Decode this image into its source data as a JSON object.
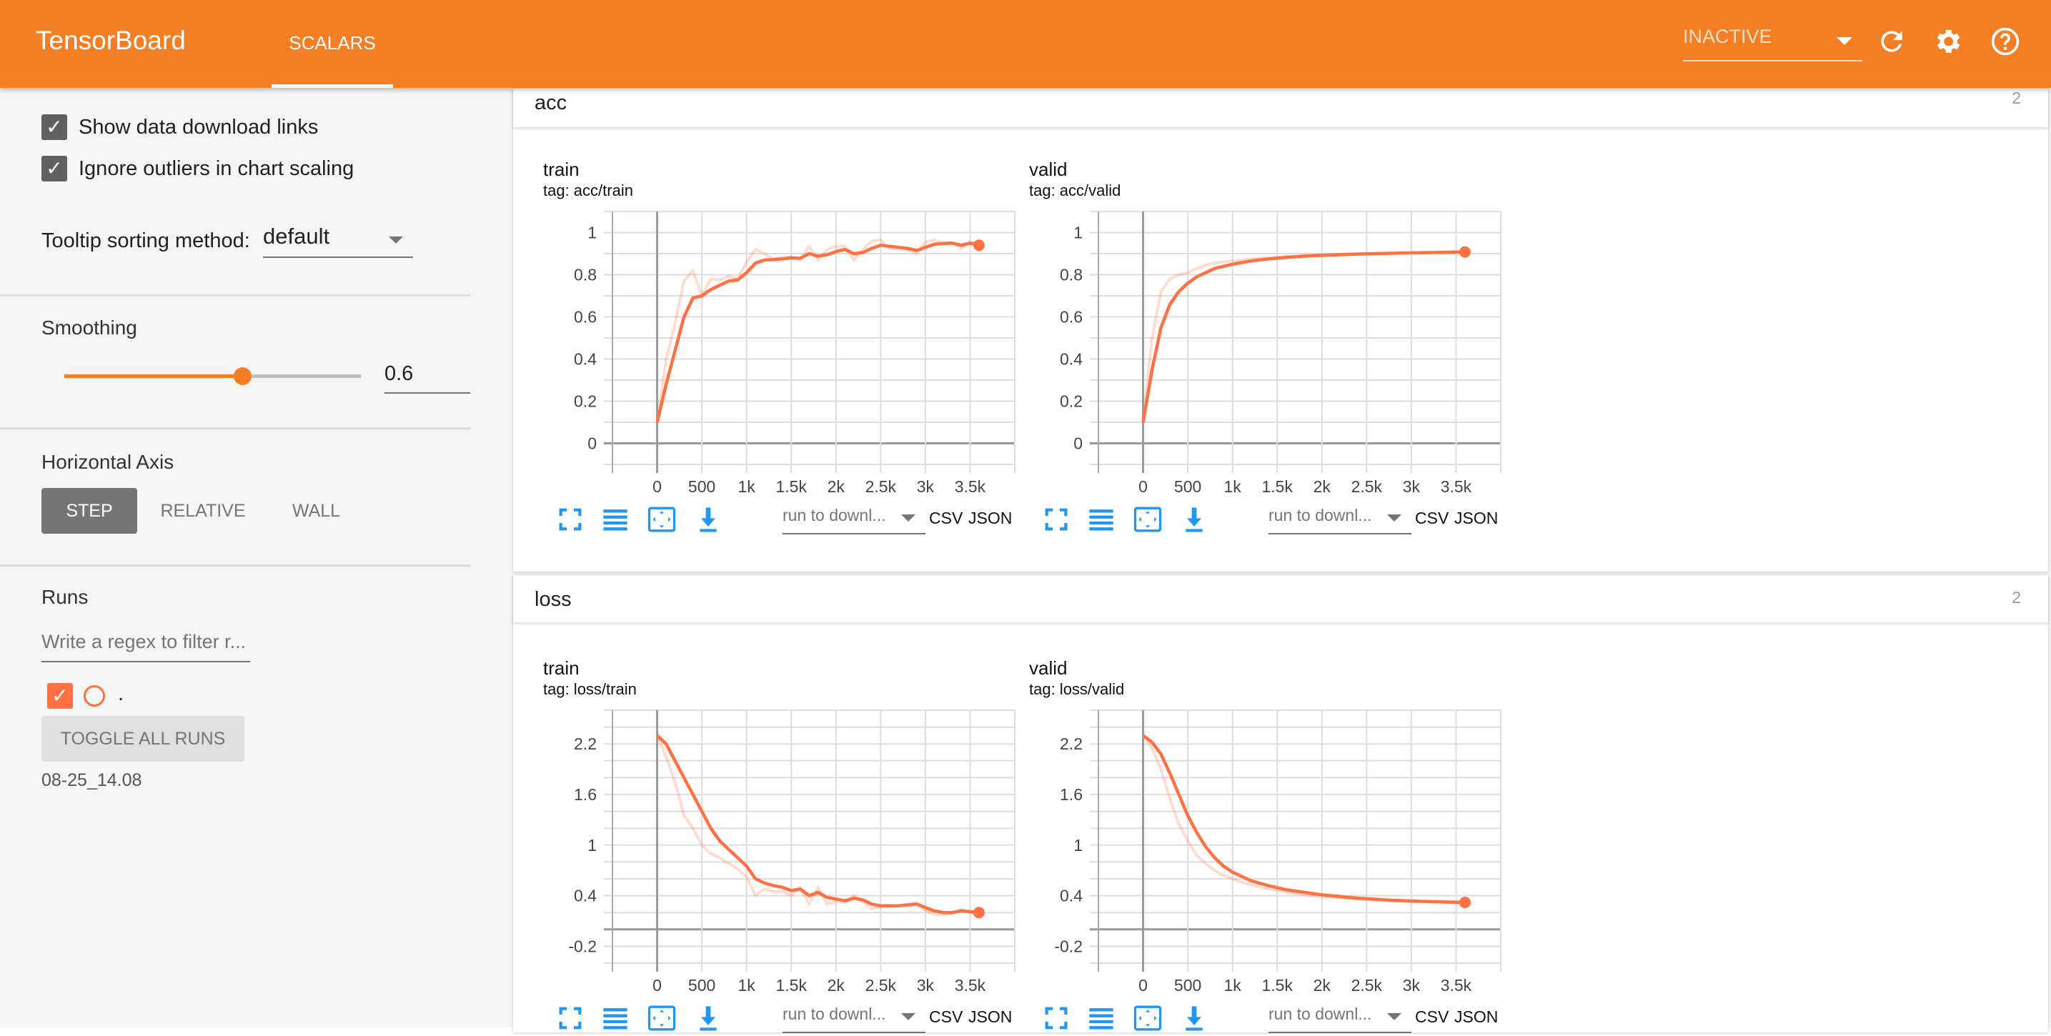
{
  "header": {
    "brand": "TensorBoard",
    "tab": "SCALARS",
    "run_state": "INACTIVE",
    "icons": [
      "refresh-icon",
      "gear-icon",
      "help-icon"
    ],
    "color": "#f47e23"
  },
  "sidebar": {
    "show_download_links": {
      "label": "Show data download links",
      "checked": true
    },
    "ignore_outliers": {
      "label": "Ignore outliers in chart scaling",
      "checked": true
    },
    "tooltip_label": "Tooltip sorting method:",
    "tooltip_value": "default",
    "smoothing_label": "Smoothing",
    "smoothing_value": "0.6",
    "smoothing_fraction": 0.6,
    "axis_label": "Horizontal Axis",
    "axis_options": [
      "STEP",
      "RELATIVE",
      "WALL"
    ],
    "axis_selected": "STEP",
    "runs_label": "Runs",
    "runs_filter_placeholder": "Write a regex to filter r...",
    "runs": [
      {
        "name": ".",
        "checked": true,
        "color": "#ff7043"
      }
    ],
    "toggle_all": "TOGGLE ALL RUNS",
    "run_dir": "08-25_14.08"
  },
  "toolbar": {
    "download_placeholder": "run to downl...",
    "csv": "CSV",
    "json": "JSON"
  },
  "cards": [
    {
      "name": "acc",
      "count": "2"
    },
    {
      "name": "loss",
      "count": "2"
    }
  ],
  "chart_data": [
    {
      "type": "line",
      "title": "train",
      "subtitle": "tag: acc/train",
      "xlim": [
        -500,
        4000
      ],
      "ylim": [
        -0.1,
        1.1
      ],
      "xticks": [
        0,
        500,
        1000,
        1500,
        2000,
        2500,
        3000,
        3500
      ],
      "xticklabels": [
        "0",
        "500",
        "1k",
        "1.5k",
        "2k",
        "2.5k",
        "3k",
        "3.5k"
      ],
      "yticks": [
        0,
        0.2,
        0.4,
        0.6,
        0.8,
        1
      ],
      "yticklabels": [
        "0",
        "0.2",
        "0.4",
        "0.6",
        "0.8",
        "1"
      ],
      "grid": true,
      "ygrid_step": 0.1,
      "color": "#ff7043",
      "x": [
        0,
        100,
        200,
        300,
        400,
        500,
        600,
        700,
        800,
        900,
        1000,
        1100,
        1200,
        1300,
        1400,
        1500,
        1600,
        1700,
        1800,
        1900,
        2000,
        2100,
        2200,
        2300,
        2400,
        2500,
        2600,
        2700,
        2800,
        2900,
        3000,
        3100,
        3200,
        3300,
        3400,
        3500,
        3600
      ],
      "raw": [
        0.1,
        0.4,
        0.57,
        0.77,
        0.82,
        0.7,
        0.78,
        0.775,
        0.795,
        0.78,
        0.86,
        0.92,
        0.9,
        0.875,
        0.88,
        0.885,
        0.87,
        0.935,
        0.87,
        0.92,
        0.935,
        0.935,
        0.87,
        0.92,
        0.96,
        0.965,
        0.925,
        0.925,
        0.92,
        0.9,
        0.955,
        0.965,
        0.95,
        0.95,
        0.925,
        0.955,
        0.94
      ],
      "smoothed": [
        0.1,
        0.28,
        0.44,
        0.6,
        0.69,
        0.7,
        0.73,
        0.75,
        0.77,
        0.775,
        0.81,
        0.855,
        0.87,
        0.872,
        0.875,
        0.88,
        0.878,
        0.9,
        0.888,
        0.895,
        0.91,
        0.92,
        0.9,
        0.905,
        0.925,
        0.94,
        0.935,
        0.93,
        0.925,
        0.915,
        0.93,
        0.945,
        0.948,
        0.95,
        0.94,
        0.95,
        0.94
      ]
    },
    {
      "type": "line",
      "title": "valid",
      "subtitle": "tag: acc/valid",
      "xlim": [
        -500,
        4000
      ],
      "ylim": [
        -0.1,
        1.1
      ],
      "xticks": [
        0,
        500,
        1000,
        1500,
        2000,
        2500,
        3000,
        3500
      ],
      "xticklabels": [
        "0",
        "500",
        "1k",
        "1.5k",
        "2k",
        "2.5k",
        "3k",
        "3.5k"
      ],
      "yticks": [
        0,
        0.2,
        0.4,
        0.6,
        0.8,
        1
      ],
      "yticklabels": [
        "0",
        "0.2",
        "0.4",
        "0.6",
        "0.8",
        "1"
      ],
      "grid": true,
      "ygrid_step": 0.1,
      "color": "#ff7043",
      "x": [
        0,
        100,
        200,
        300,
        400,
        500,
        600,
        700,
        800,
        900,
        1000,
        1200,
        1400,
        1600,
        1800,
        2000,
        2400,
        2800,
        3200,
        3600
      ],
      "raw": [
        0.1,
        0.5,
        0.72,
        0.78,
        0.8,
        0.81,
        0.83,
        0.845,
        0.855,
        0.86,
        0.865,
        0.875,
        0.88,
        0.885,
        0.89,
        0.895,
        0.9,
        0.903,
        0.906,
        0.909
      ],
      "smoothed": [
        0.1,
        0.35,
        0.55,
        0.66,
        0.72,
        0.76,
        0.79,
        0.81,
        0.83,
        0.84,
        0.85,
        0.865,
        0.875,
        0.882,
        0.888,
        0.892,
        0.898,
        0.902,
        0.905,
        0.908
      ]
    },
    {
      "type": "line",
      "title": "train",
      "subtitle": "tag: loss/train",
      "xlim": [
        -500,
        4000
      ],
      "ylim": [
        -0.4,
        2.6
      ],
      "xticks": [
        0,
        500,
        1000,
        1500,
        2000,
        2500,
        3000,
        3500
      ],
      "xticklabels": [
        "0",
        "500",
        "1k",
        "1.5k",
        "2k",
        "2.5k",
        "3k",
        "3.5k"
      ],
      "yticks": [
        -0.2,
        0.4,
        1,
        1.6,
        2.2
      ],
      "yticklabels": [
        "-0.2",
        "0.4",
        "1",
        "1.6",
        "2.2"
      ],
      "grid": true,
      "ygrid_step": 0.2,
      "color": "#ff7043",
      "x": [
        0,
        100,
        200,
        300,
        400,
        500,
        600,
        700,
        800,
        900,
        1000,
        1100,
        1200,
        1300,
        1400,
        1500,
        1600,
        1700,
        1800,
        1900,
        2000,
        2100,
        2200,
        2300,
        2400,
        2500,
        2600,
        2700,
        2800,
        2900,
        3000,
        3100,
        3200,
        3300,
        3400,
        3500,
        3600
      ],
      "raw": [
        2.3,
        2.05,
        1.75,
        1.35,
        1.2,
        1.0,
        0.9,
        0.85,
        0.78,
        0.72,
        0.62,
        0.4,
        0.48,
        0.45,
        0.45,
        0.4,
        0.5,
        0.3,
        0.5,
        0.3,
        0.33,
        0.32,
        0.4,
        0.33,
        0.25,
        0.26,
        0.27,
        0.28,
        0.3,
        0.32,
        0.22,
        0.18,
        0.17,
        0.19,
        0.24,
        0.2,
        0.19
      ],
      "smoothed": [
        2.3,
        2.2,
        2.0,
        1.8,
        1.6,
        1.4,
        1.2,
        1.05,
        0.95,
        0.85,
        0.75,
        0.6,
        0.55,
        0.52,
        0.5,
        0.46,
        0.48,
        0.4,
        0.44,
        0.38,
        0.36,
        0.34,
        0.37,
        0.35,
        0.3,
        0.28,
        0.28,
        0.28,
        0.29,
        0.3,
        0.26,
        0.22,
        0.2,
        0.2,
        0.22,
        0.21,
        0.2
      ]
    },
    {
      "type": "line",
      "title": "valid",
      "subtitle": "tag: loss/valid",
      "xlim": [
        -500,
        4000
      ],
      "ylim": [
        -0.4,
        2.6
      ],
      "xticks": [
        0,
        500,
        1000,
        1500,
        2000,
        2500,
        3000,
        3500
      ],
      "xticklabels": [
        "0",
        "500",
        "1k",
        "1.5k",
        "2k",
        "2.5k",
        "3k",
        "3.5k"
      ],
      "yticks": [
        -0.2,
        0.4,
        1,
        1.6,
        2.2
      ],
      "yticklabels": [
        "-0.2",
        "0.4",
        "1",
        "1.6",
        "2.2"
      ],
      "grid": true,
      "ygrid_step": 0.2,
      "color": "#ff7043",
      "x": [
        0,
        100,
        200,
        300,
        400,
        500,
        600,
        700,
        800,
        900,
        1000,
        1200,
        1400,
        1600,
        1800,
        2000,
        2400,
        2800,
        3200,
        3600
      ],
      "raw": [
        2.3,
        2.15,
        1.9,
        1.55,
        1.25,
        1.05,
        0.88,
        0.78,
        0.7,
        0.64,
        0.6,
        0.53,
        0.48,
        0.44,
        0.41,
        0.39,
        0.36,
        0.34,
        0.33,
        0.32
      ],
      "smoothed": [
        2.3,
        2.22,
        2.08,
        1.85,
        1.6,
        1.35,
        1.15,
        0.98,
        0.85,
        0.75,
        0.68,
        0.58,
        0.52,
        0.47,
        0.44,
        0.41,
        0.37,
        0.345,
        0.33,
        0.32
      ]
    }
  ]
}
